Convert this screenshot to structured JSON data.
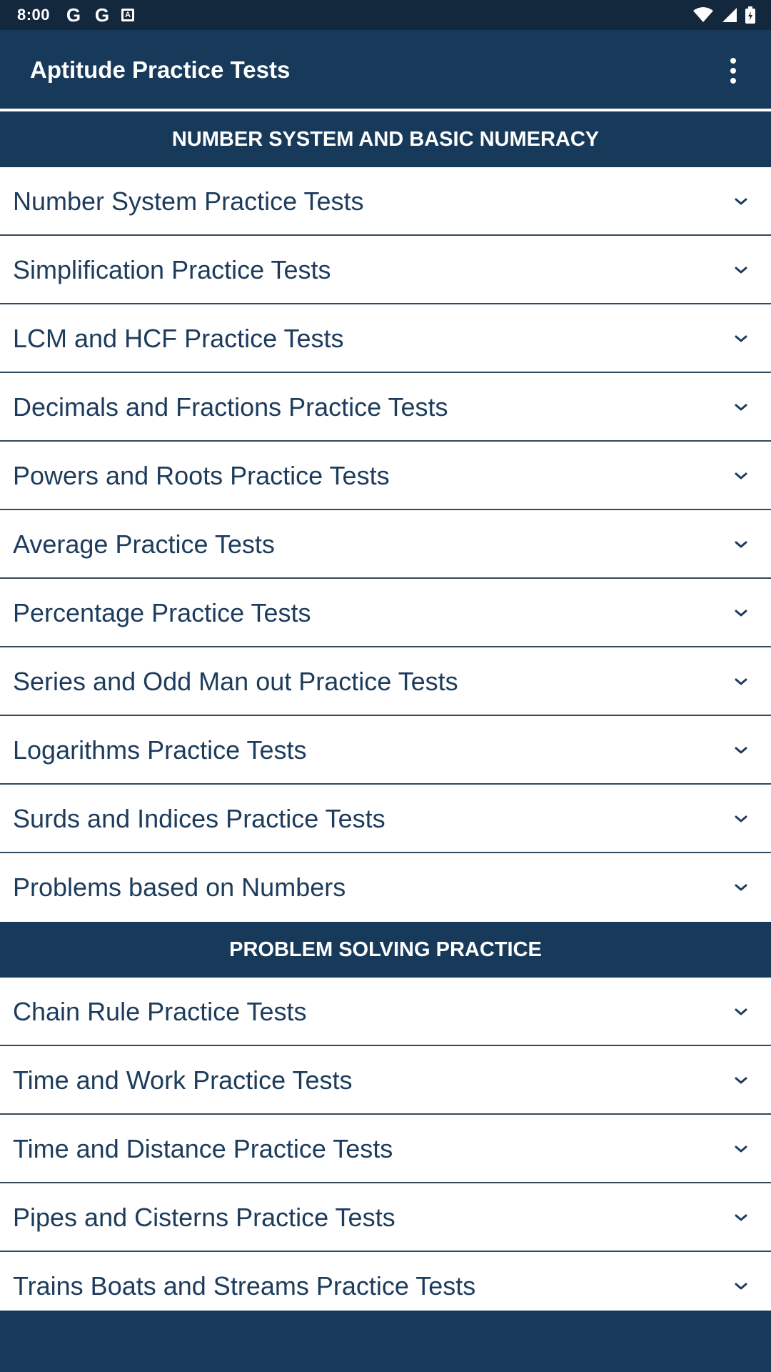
{
  "status_bar": {
    "time": "8:00",
    "left_icons": [
      "google-icon",
      "google-icon",
      "keyboard-a-icon"
    ],
    "right_icons": [
      "wifi-icon",
      "cellular-signal-icon",
      "battery-icon"
    ]
  },
  "app_bar": {
    "title": "Aptitude Practice Tests",
    "menu_icon": "more-vertical-icon"
  },
  "sections": [
    {
      "title": "NUMBER SYSTEM AND BASIC NUMERACY",
      "items": [
        "Number System Practice Tests",
        "Simplification Practice Tests",
        "LCM and HCF Practice Tests",
        "Decimals and Fractions Practice Tests",
        "Powers and Roots Practice Tests",
        "Average Practice Tests",
        "Percentage Practice Tests",
        "Series and Odd Man out Practice Tests",
        "Logarithms Practice Tests",
        "Surds and Indices Practice Tests",
        "Problems based on Numbers"
      ]
    },
    {
      "title": "PROBLEM SOLVING PRACTICE",
      "items": [
        "Chain Rule Practice Tests",
        "Time and Work Practice Tests",
        "Time and Distance Practice Tests",
        "Pipes and Cisterns Practice Tests",
        "Trains Boats and Streams Practice Tests"
      ]
    }
  ],
  "colors": {
    "primary": "#183a5a",
    "status_bar": "#13273d",
    "item_text": "#1d3c5c",
    "divider": "#33495e"
  }
}
